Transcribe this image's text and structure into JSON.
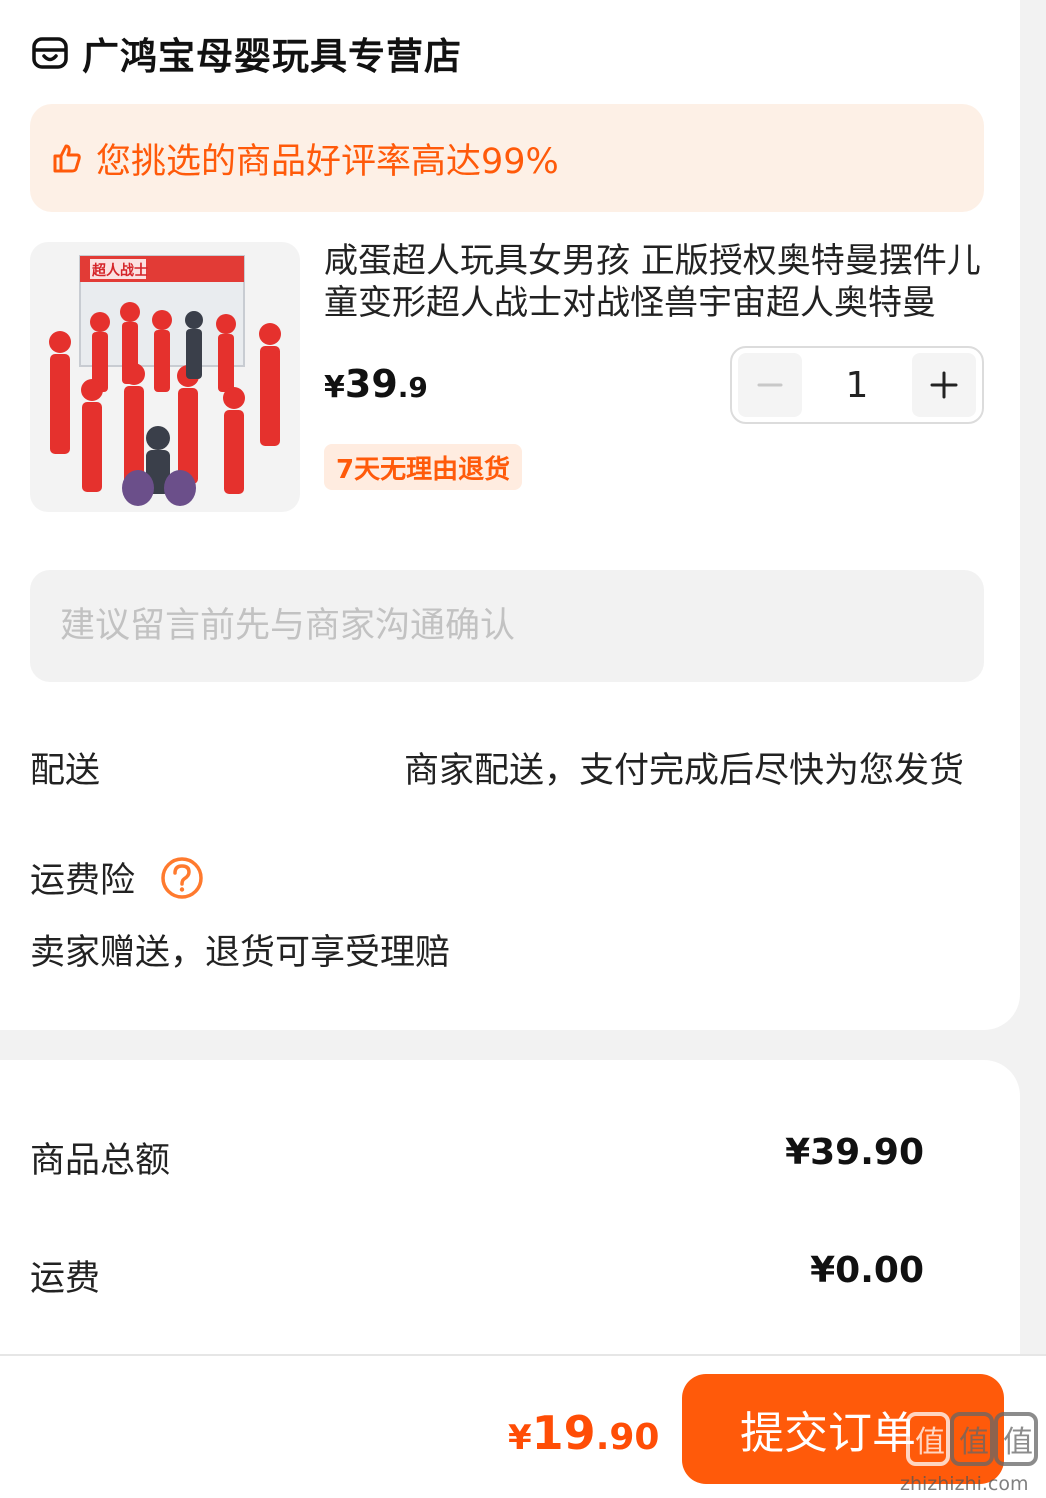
{
  "store": {
    "icon": "store-icon",
    "name": "广鸿宝母婴玩具专营店"
  },
  "rating_banner": {
    "icon": "thumbs-up-icon",
    "text": "您挑选的商品好评率高达99%",
    "color": "#ff5a0a",
    "background": "#fdf0e6"
  },
  "product": {
    "image_icon": "product-image",
    "image_text": "超人战士",
    "title": "咸蛋超人玩具女男孩 正版授权奥特曼摆件儿童变形超人战士对战怪兽宇宙超人奥特曼",
    "price_currency": "¥",
    "price_int": "39",
    "price_dec": ".9",
    "quantity": "1",
    "decrement_icon": "minus-icon",
    "increment_icon": "plus-icon",
    "return_badge": "7天无理由退货"
  },
  "message": {
    "placeholder": "建议留言前先与商家沟通确认"
  },
  "delivery": {
    "label": "配送",
    "value": "商家配送，支付完成后尽快为您发货"
  },
  "insurance": {
    "label": "运费险",
    "help_icon": "question-circle-icon",
    "description": "卖家赠送，退货可享受理赔"
  },
  "summary": {
    "goods_total_label": "商品总额",
    "goods_total_value": "¥39.90",
    "shipping_label": "运费",
    "shipping_value": "¥0.00"
  },
  "footer": {
    "total_currency": "¥",
    "total_int": "19",
    "total_dec": ".90",
    "submit_label": "提交订单",
    "accent_color": "#ff5a0a"
  },
  "watermark": {
    "logo_text": "值",
    "url_text": "zhizhizhi.com"
  }
}
